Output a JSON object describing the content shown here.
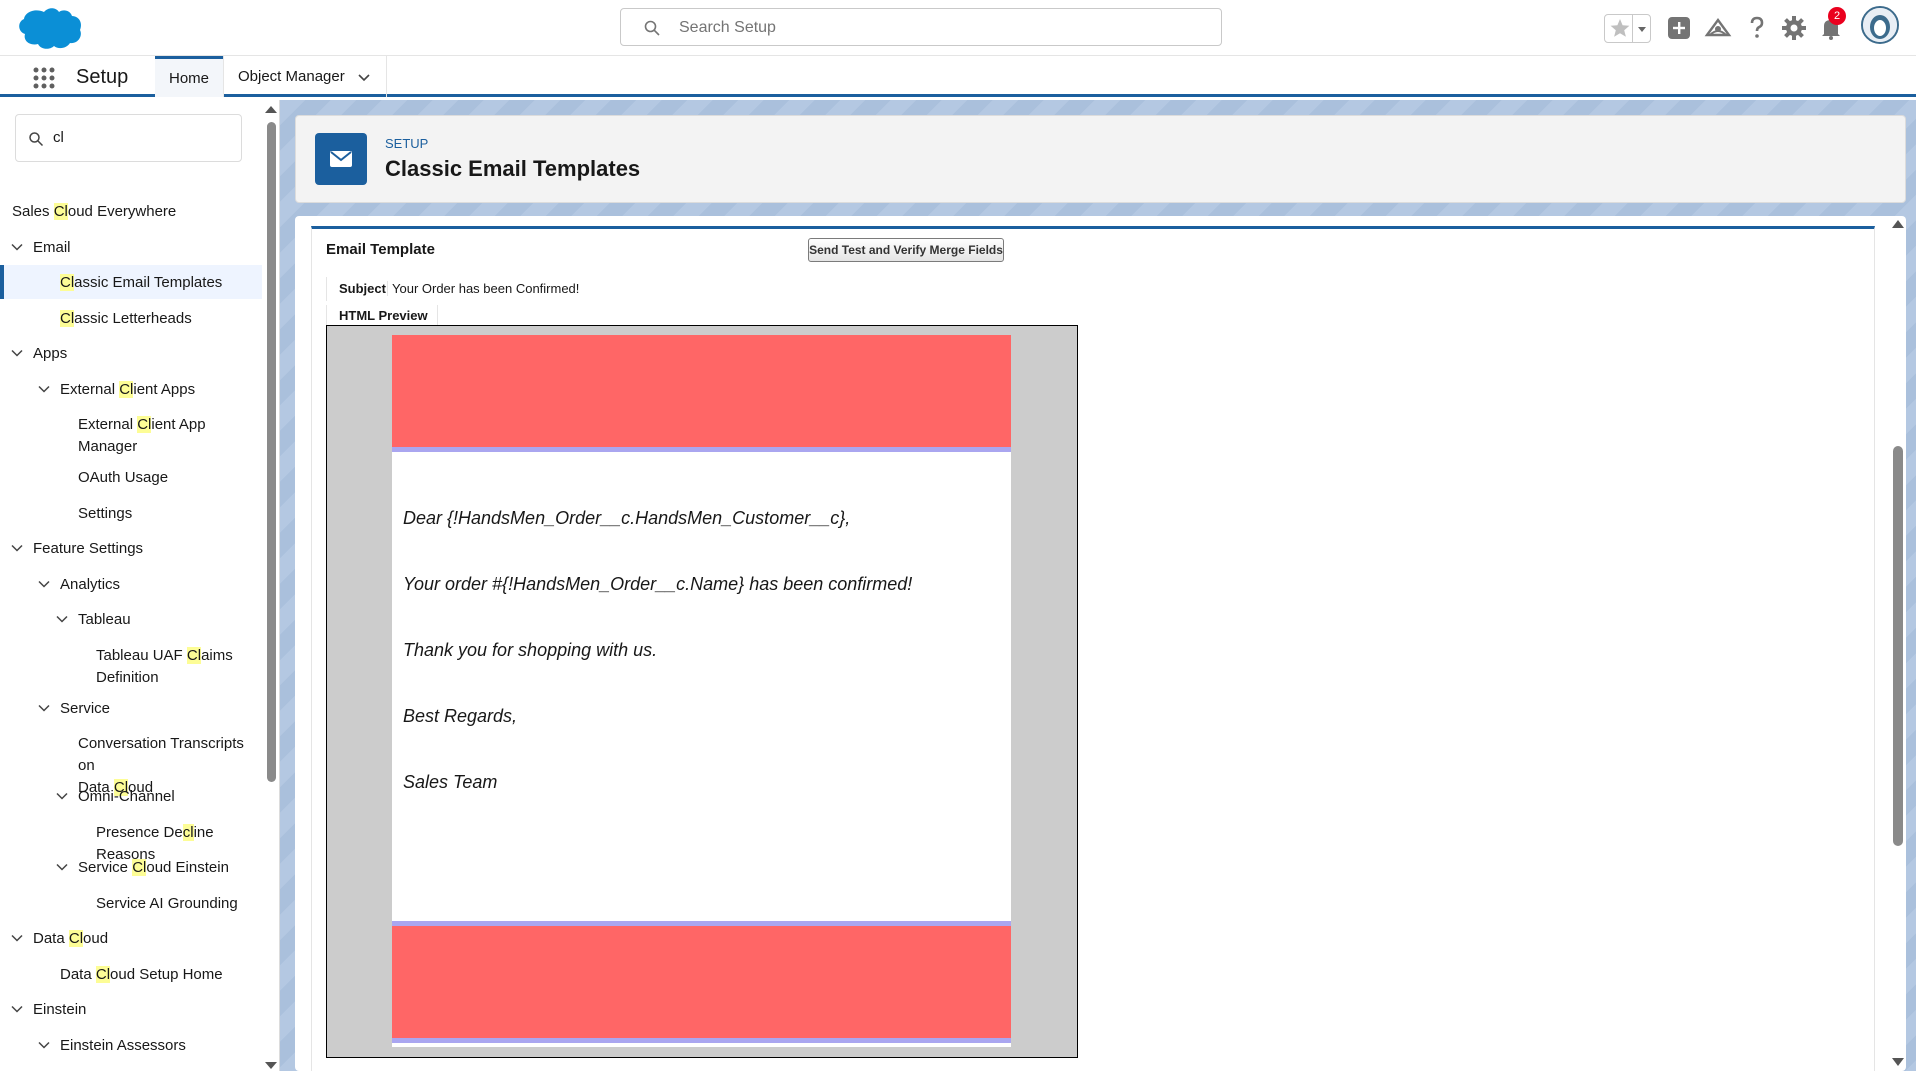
{
  "header": {
    "search_placeholder": "Search Setup",
    "notification_count": "2",
    "icons": [
      "salesforce-cloud-logo",
      "search-icon",
      "favorites-star-icon",
      "favorites-dropdown-icon",
      "global-add-icon",
      "trailhead-icon",
      "help-icon",
      "setup-gear-icon",
      "notifications-bell-icon",
      "user-avatar"
    ]
  },
  "context_bar": {
    "app_name": "Setup",
    "tabs": [
      {
        "label": "Home",
        "active": true
      },
      {
        "label": "Object Manager",
        "active": false
      }
    ]
  },
  "sidebar": {
    "quick_find_value": "cl",
    "items": [
      {
        "pre": "Sales ",
        "hl": "Cl",
        "post": "oud Everywhere",
        "level": 0,
        "chevron": false
      },
      {
        "pre": "Email",
        "hl": "",
        "post": "",
        "level": 0,
        "chevron": true
      },
      {
        "pre": "",
        "hl": "Cl",
        "post": "assic Email Templates",
        "level": 2,
        "chevron": false,
        "selected": true
      },
      {
        "pre": "",
        "hl": "Cl",
        "post": "assic Letterheads",
        "level": 2,
        "chevron": false
      },
      {
        "pre": "Apps",
        "hl": "",
        "post": "",
        "level": 0,
        "chevron": true
      },
      {
        "pre": "External ",
        "hl": "Cl",
        "post": "ient Apps",
        "level": 1,
        "chevron": true
      },
      {
        "pre": "External ",
        "hl": "Cl",
        "post": "ient App",
        "line2": "Manager",
        "level": 3,
        "chevron": false
      },
      {
        "pre": "OAuth Usage",
        "hl": "",
        "post": "",
        "level": 3,
        "chevron": false
      },
      {
        "pre": "Settings",
        "hl": "",
        "post": "",
        "level": 3,
        "chevron": false
      },
      {
        "pre": "Feature Settings",
        "hl": "",
        "post": "",
        "level": 0,
        "chevron": true
      },
      {
        "pre": "Analytics",
        "hl": "",
        "post": "",
        "level": 1,
        "chevron": true
      },
      {
        "pre": "Tableau",
        "hl": "",
        "post": "",
        "level": 2,
        "chevron": true
      },
      {
        "pre": "Tableau UAF ",
        "hl": "Cl",
        "post": "aims",
        "line2": "Definition",
        "level": 4,
        "chevron": false
      },
      {
        "pre": "Service",
        "hl": "",
        "post": "",
        "level": 1,
        "chevron": true
      },
      {
        "pre": "Conversation Transcripts on",
        "hl": "",
        "post": "",
        "line2_pre": "Data ",
        "line2_hl": "Cl",
        "line2_post": "oud",
        "level": 3,
        "chevron": false
      },
      {
        "pre": "Omni-Channel",
        "hl": "",
        "post": "",
        "level": 2,
        "chevron": true
      },
      {
        "pre": "Presence De",
        "hl": "cl",
        "post": "ine Reasons",
        "level": 4,
        "chevron": false
      },
      {
        "pre": "Service ",
        "hl": "Cl",
        "post": "oud Einstein",
        "level": 2,
        "chevron": true
      },
      {
        "pre": "Service AI Grounding",
        "hl": "",
        "post": "",
        "level": 4,
        "chevron": false
      },
      {
        "pre": "Data ",
        "hl": "Cl",
        "post": "oud",
        "level": 0,
        "chevron": true
      },
      {
        "pre": "Data ",
        "hl": "Cl",
        "post": "oud Setup Home",
        "level": 2,
        "chevron": false
      },
      {
        "pre": "Einstein",
        "hl": "",
        "post": "",
        "level": 0,
        "chevron": true
      },
      {
        "pre": "Einstein Assessors",
        "hl": "",
        "post": "",
        "level": 1,
        "chevron": true
      }
    ]
  },
  "page_header": {
    "eyebrow": "SETUP",
    "title": "Classic Email Templates",
    "icon": "email-icon"
  },
  "email_template": {
    "section_title": "Email Template",
    "send_button": "Send Test and Verify Merge Fields",
    "subject_label": "Subject",
    "subject_value": "Your Order has been Confirmed!",
    "preview_tab": "HTML Preview",
    "body_lines": [
      "Dear {!HandsMen_Order__c.HandsMen_Customer__c},",
      "Your order #{!HandsMen_Order__c.Name} has been confirmed!",
      "Thank you for shopping with us.",
      "Best Regards,",
      "Sales Team"
    ],
    "colors": {
      "letterhead_band": "#ff6666",
      "letterhead_line": "#aaa6f0",
      "frame_background": "#cccccc"
    }
  },
  "colors": {
    "brand_blue": "#1b5f9e",
    "highlight": "#fdfd96"
  }
}
